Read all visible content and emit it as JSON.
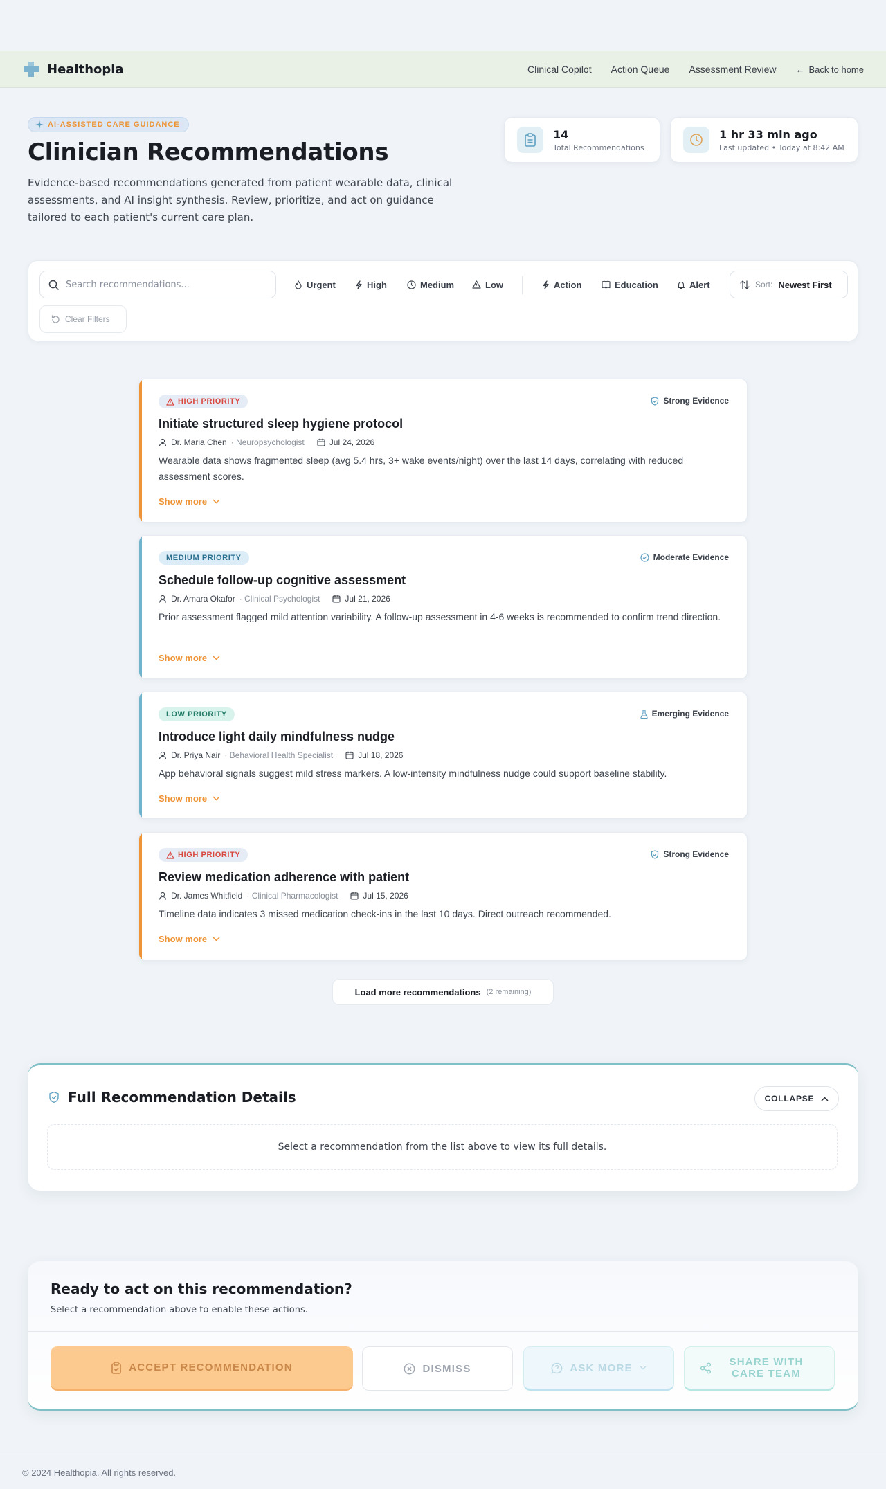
{
  "nav": {
    "brand": "Healthopia",
    "links": [
      "Clinical Copilot",
      "Action Queue",
      "Assessment Review"
    ],
    "back": "Back to home"
  },
  "hero": {
    "tag": "AI-ASSISTED CARE GUIDANCE",
    "title": "Clinician Recommendations",
    "description": "Evidence-based recommendations generated from patient wearable data, clinical assessments, and AI insight synthesis. Review, prioritize, and act on guidance tailored to each patient's current care plan."
  },
  "stats": [
    {
      "value": "14",
      "label": "Total Recommendations",
      "icon": "clipboard-icon"
    },
    {
      "value": "1 hr 33 min ago",
      "label": "Last updated • Today at 8:42 AM",
      "icon": "clock-icon"
    }
  ],
  "filters": {
    "search_placeholder": "Search recommendations...",
    "priority": [
      "Urgent",
      "High",
      "Medium",
      "Low"
    ],
    "type": [
      "Action",
      "Education",
      "Alert"
    ],
    "sort_label": "Sort:",
    "sort_value": "Newest First",
    "clear": "Clear Filters"
  },
  "cards": [
    {
      "priority": "HIGH PRIORITY",
      "level": "high",
      "evidence": "Strong Evidence",
      "title": "Initiate structured sleep hygiene protocol",
      "author": "Dr. Maria Chen",
      "role": "· Neuropsychologist",
      "date": "Jul 24, 2026",
      "description": "Wearable data shows fragmented sleep (avg 5.4 hrs, 3+ wake events/night) over the last 14 days, correlating with reduced assessment scores.",
      "more": "Show more"
    },
    {
      "priority": "MEDIUM PRIORITY",
      "level": "medium",
      "evidence": "Moderate Evidence",
      "title": "Schedule follow-up cognitive assessment",
      "author": "Dr. Amara Okafor",
      "role": "· Clinical Psychologist",
      "date": "Jul 21, 2026",
      "description": "Prior assessment flagged mild attention variability. A follow-up assessment in 4-6 weeks is recommended to confirm trend direction.",
      "more": "Show more"
    },
    {
      "priority": "LOW PRIORITY",
      "level": "low",
      "evidence": "Emerging Evidence",
      "title": "Introduce light daily mindfulness nudge",
      "author": "Dr. Priya Nair",
      "role": "· Behavioral Health Specialist",
      "date": "Jul 18, 2026",
      "description": "App behavioral signals suggest mild stress markers. A low-intensity mindfulness nudge could support baseline stability.",
      "more": "Show more"
    },
    {
      "priority": "HIGH PRIORITY",
      "level": "high",
      "evidence": "Strong Evidence",
      "title": "Review medication adherence with patient",
      "author": "Dr. James Whitfield",
      "role": "· Clinical Pharmacologist",
      "date": "Jul 15, 2026",
      "description": "Timeline data indicates 3 missed medication check-ins in the last 10 days. Direct outreach recommended.",
      "more": "Show more"
    }
  ],
  "load_more": {
    "label": "Load more recommendations",
    "remaining": "(2 remaining)"
  },
  "details": {
    "title": "Full Recommendation Details",
    "collapse": "COLLAPSE",
    "empty": "Select a recommendation from the list above to view its full details."
  },
  "actions": {
    "title": "Ready to act on this recommendation?",
    "subtitle": "Select a recommendation above to enable these actions.",
    "accept": "ACCEPT RECOMMENDATION",
    "dismiss": "DISMISS",
    "ask": "ASK MORE",
    "share_line1": "SHARE WITH",
    "share_line2": "CARE TEAM"
  },
  "footer": "© 2024 Healthopia. All rights reserved.",
  "colors": {
    "accent_orange": "#ee9436",
    "accent_teal": "#7fbfc6",
    "high": "#ee9436",
    "medium": "#6fb3cc",
    "low": "#6fb3cc"
  }
}
